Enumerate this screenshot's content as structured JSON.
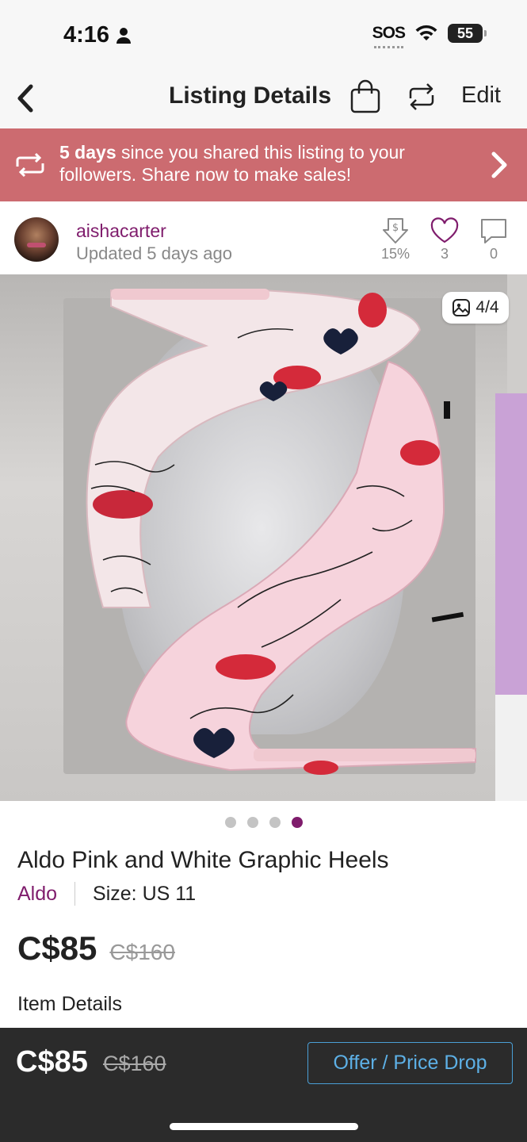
{
  "status_bar": {
    "time": "4:16",
    "carrier": "SOS",
    "battery": "55"
  },
  "nav": {
    "title": "Listing Details",
    "edit_label": "Edit"
  },
  "share_banner": {
    "highlight": "5 days",
    "message": " since you shared this listing to your followers. Share now to make sales!"
  },
  "seller": {
    "username": "aishacarter",
    "updated": "Updated 5 days ago",
    "stats": {
      "discount": "15%",
      "likes": "3",
      "comments": "0"
    }
  },
  "image": {
    "counter": "4/4",
    "total_images": 4,
    "active_index": 3
  },
  "item": {
    "title": "Aldo Pink and White Graphic Heels",
    "brand": "Aldo",
    "size": "Size: US 11",
    "price": "C$85",
    "original_price": "C$160",
    "details_label": "Item Details"
  },
  "bottom_bar": {
    "price": "C$85",
    "original_price": "C$160",
    "offer_label": "Offer / Price Drop"
  },
  "colors": {
    "brand_purple": "#7f1c6c",
    "banner": "#cc6b70",
    "bottom_bar": "#2b2b2b",
    "offer_blue": "#5db0e6"
  }
}
